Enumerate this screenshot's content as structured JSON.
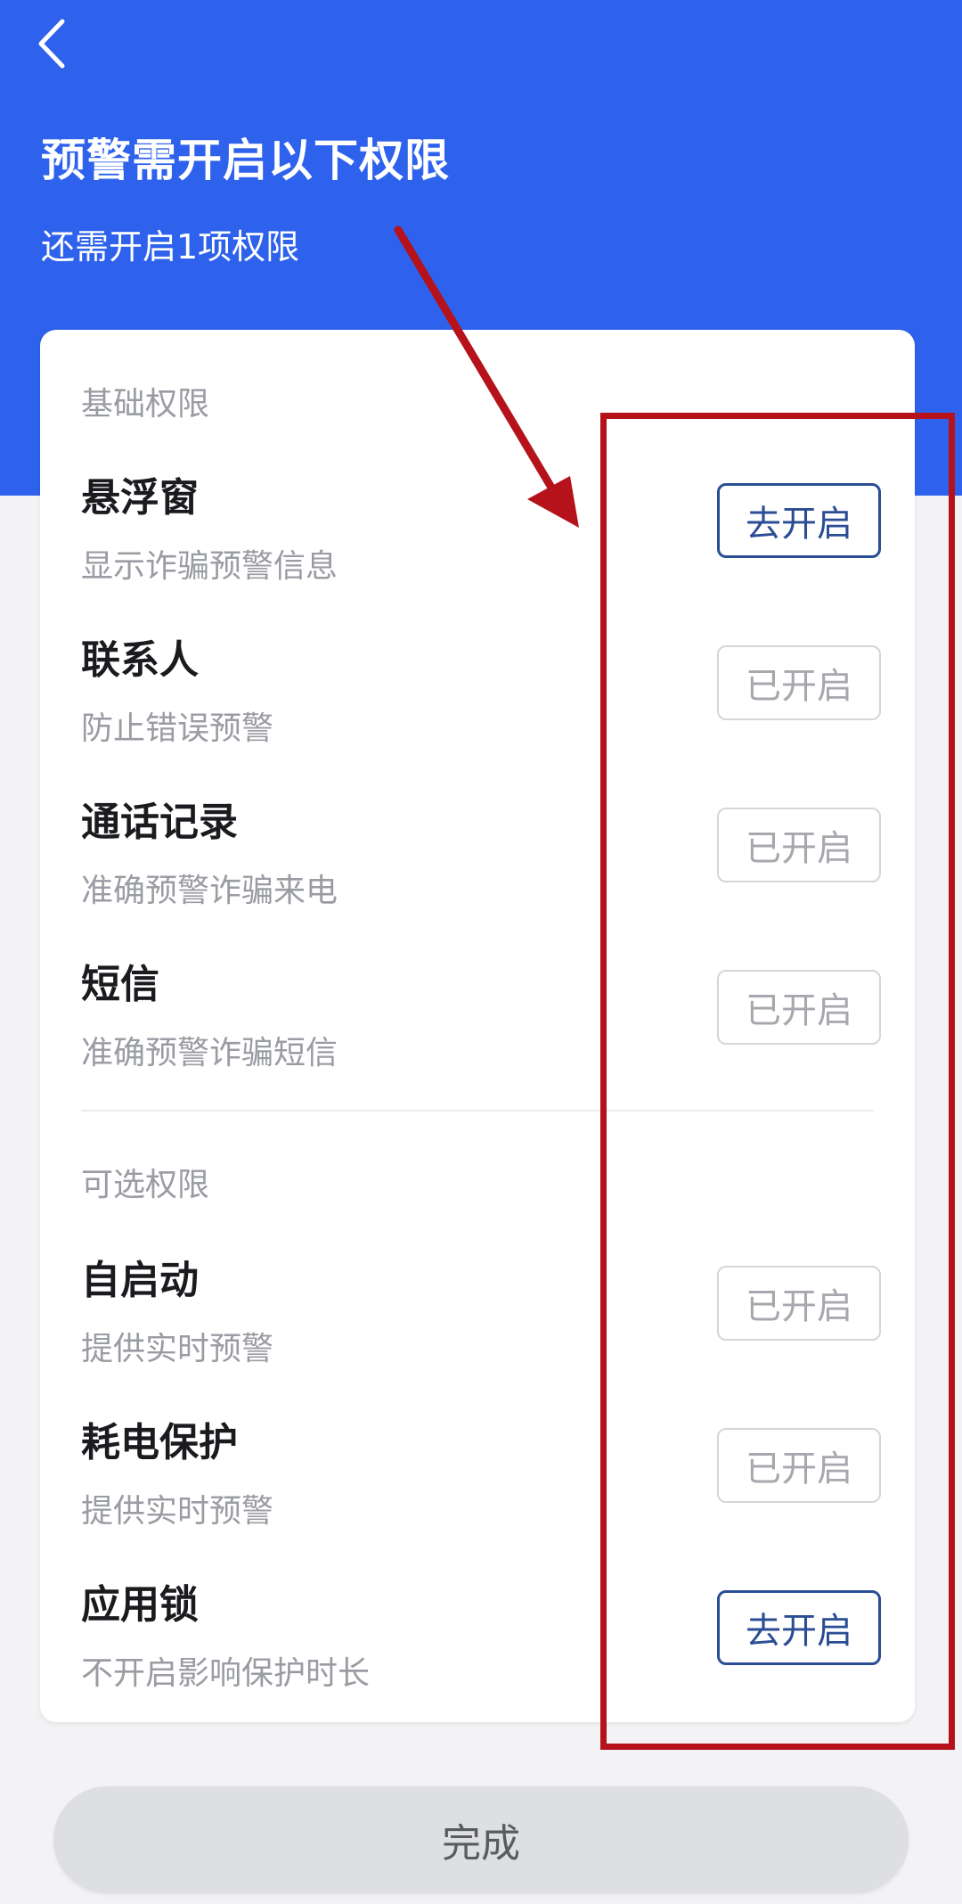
{
  "header": {
    "back_icon": "chevron-left-icon",
    "title": "预警需开启以下权限",
    "subtitle": "还需开启1项权限"
  },
  "sections": [
    {
      "heading": "基础权限",
      "items": [
        {
          "title": "悬浮窗",
          "desc": "显示诈骗预警信息",
          "button": "去开启",
          "enabled": false
        },
        {
          "title": "联系人",
          "desc": "防止错误预警",
          "button": "已开启",
          "enabled": true
        },
        {
          "title": "通话记录",
          "desc": "准确预警诈骗来电",
          "button": "已开启",
          "enabled": true
        },
        {
          "title": "短信",
          "desc": "准确预警诈骗短信",
          "button": "已开启",
          "enabled": true
        }
      ]
    },
    {
      "heading": "可选权限",
      "items": [
        {
          "title": "自启动",
          "desc": "提供实时预警",
          "button": "已开启",
          "enabled": true
        },
        {
          "title": "耗电保护",
          "desc": "提供实时预警",
          "button": "已开启",
          "enabled": true
        },
        {
          "title": "应用锁",
          "desc": "不开启影响保护时长",
          "button": "去开启",
          "enabled": false
        }
      ]
    }
  ],
  "footer": {
    "done_label": "完成"
  },
  "colors": {
    "header_blue": "#2e62ec",
    "active_button": "#2a4d94",
    "annotation_red": "#b5121b"
  }
}
